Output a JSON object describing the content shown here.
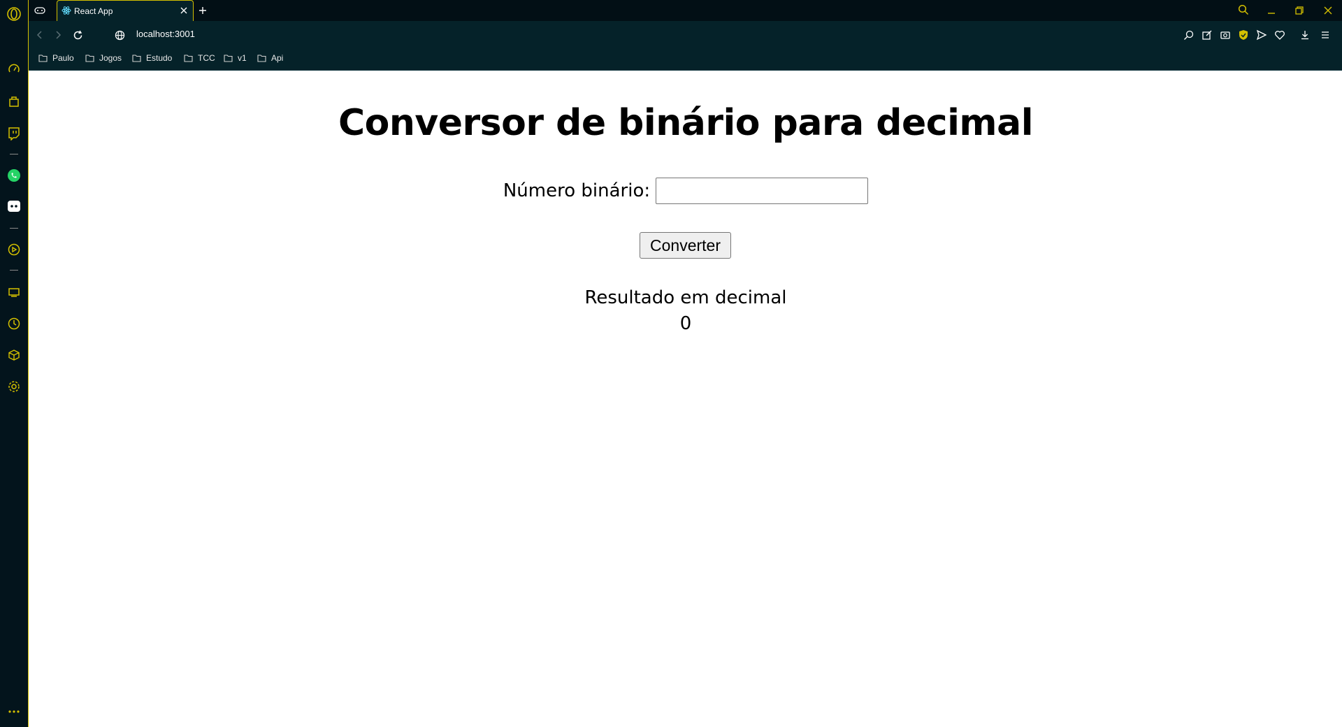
{
  "browser": {
    "tab": {
      "title": "React App"
    },
    "address_bar": {
      "url": "localhost:3001"
    },
    "bookmarks": [
      {
        "label": "Paulo"
      },
      {
        "label": "Jogos"
      },
      {
        "label": "Estudo"
      },
      {
        "label": "TCC"
      },
      {
        "label": "v1"
      },
      {
        "label": "Api"
      }
    ],
    "colors": {
      "chrome_bg": "#052229",
      "sidebar_bg": "#03141c",
      "accent": "#d4c000"
    }
  },
  "app": {
    "title": "Conversor de binário para decimal",
    "input_label": "Número binário:",
    "input_value": "",
    "button_label": "Converter",
    "result_label": "Resultado em decimal",
    "result_value": "0"
  }
}
